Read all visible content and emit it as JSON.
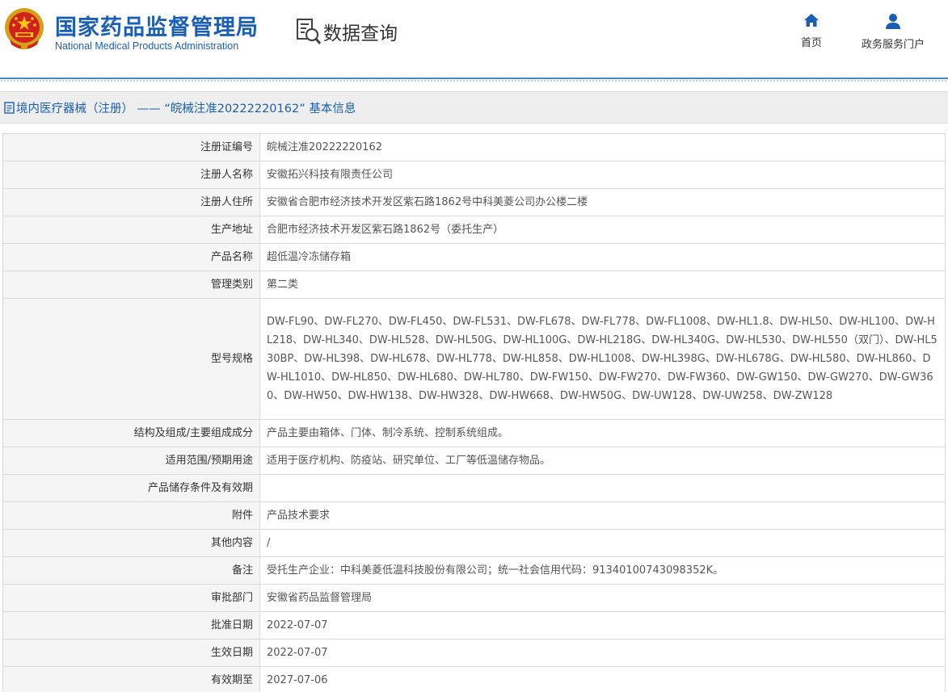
{
  "header": {
    "org_name_cn": "国家药品监督管理局",
    "org_name_en": "National Medical Products Administration",
    "query_label": "数据查询",
    "nav": [
      {
        "label": "首页",
        "icon": "home-icon"
      },
      {
        "label": "政务服务门户",
        "icon": "user-icon"
      }
    ]
  },
  "colors": {
    "brand_blue": "#1b5fb5",
    "title_blue": "#1a5fae",
    "divider_blue": "#4a89c8"
  },
  "title_bar": {
    "text": "境内医疗器械（注册） —— “皖械注准20222220162” 基本信息"
  },
  "info": [
    {
      "label": "注册证编号",
      "value": "皖械注准20222220162"
    },
    {
      "label": "注册人名称",
      "value": "安徽拓兴科技有限责任公司"
    },
    {
      "label": "注册人住所",
      "value": "安徽省合肥市经济技术开发区紫石路1862号中科美菱公司办公楼二楼"
    },
    {
      "label": "生产地址",
      "value": "合肥市经济技术开发区紫石路1862号（委托生产）"
    },
    {
      "label": "产品名称",
      "value": "超低温冷冻储存箱"
    },
    {
      "label": "管理类别",
      "value": "第二类"
    },
    {
      "label": "型号规格",
      "value": "DW-FL90、DW-FL270、DW-FL450、DW-FL531、DW-FL678、DW-FL778、DW-FL1008、DW-HL1.8、DW-HL50、DW-HL100、DW-HL218、DW-HL340、DW-HL528、DW-HL50G、DW-HL100G、DW-HL218G、DW-HL340G、DW-HL530、DW-HL550（双门）、DW-HL530BP、DW-HL398、DW-HL678、DW-HL778、DW-HL858、DW-HL1008、DW-HL398G、DW-HL678G、DW-HL580、DW-HL860、DW-HL1010、DW-HL850、DW-HL680、DW-HL780、DW-FW150、DW-FW270、DW-FW360、DW-GW150、DW-GW270、DW-GW360、DW-HW50、DW-HW138、DW-HW328、DW-HW668、DW-HW50G、DW-UW128、DW-UW258、DW-ZW128"
    },
    {
      "label": "结构及组成/主要组成成分",
      "value": "产品主要由箱体、门体、制冷系统、控制系统组成。"
    },
    {
      "label": "适用范围/预期用途",
      "value": "适用于医疗机构、防疫站、研究单位、工厂等低温储存物品。"
    },
    {
      "label": "产品储存条件及有效期",
      "value": ""
    },
    {
      "label": "附件",
      "value": "产品技术要求"
    },
    {
      "label": "其他内容",
      "value": "/"
    },
    {
      "label": "备注",
      "value": "受托生产企业：中科美菱低温科技股份有限公司；统一社会信用代码：91340100743098352K。"
    },
    {
      "label": "审批部门",
      "value": "安徽省药品监督管理局"
    },
    {
      "label": "批准日期",
      "value": "2022-07-07"
    },
    {
      "label": "生效日期",
      "value": "2022-07-07"
    },
    {
      "label": "有效期至",
      "value": "2027-07-06"
    }
  ]
}
